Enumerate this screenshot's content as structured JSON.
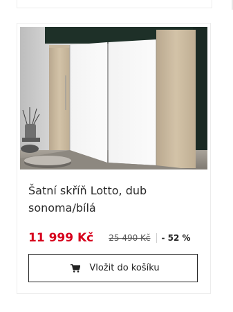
{
  "product": {
    "title": "Šatní skříň Lotto, dub sonoma/bílá",
    "price": "11 999 Kč",
    "old_price": "25 490 Kč",
    "discount": "- 52 %",
    "image_icon": "wardrobe-product-photo"
  },
  "cart_button": {
    "label": "Vložit do košíku",
    "icon": "cart-icon"
  },
  "colors": {
    "price": "#d6001c",
    "button_border": "#222222",
    "card_border": "#ececec"
  }
}
